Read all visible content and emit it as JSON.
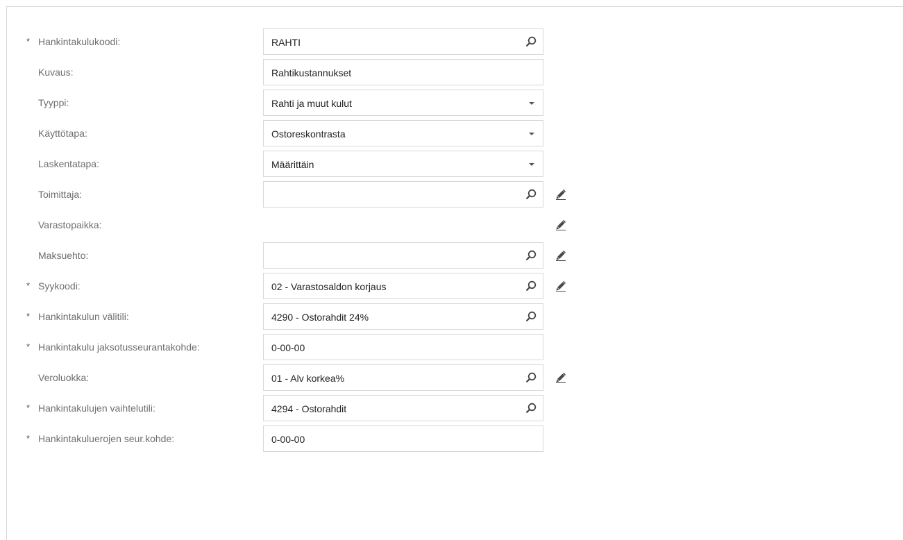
{
  "form": {
    "rows": [
      {
        "required": true,
        "label": "Hankintakulukoodi:",
        "value": "RAHTI",
        "control": "lookup",
        "editable": false
      },
      {
        "required": false,
        "label": "Kuvaus:",
        "value": "Rahtikustannukset",
        "control": "text",
        "editable": false
      },
      {
        "required": false,
        "label": "Tyyppi:",
        "value": "Rahti ja muut kulut",
        "control": "select",
        "editable": false
      },
      {
        "required": false,
        "label": "Käyttötapa:",
        "value": "Ostoreskontrasta",
        "control": "select",
        "editable": false
      },
      {
        "required": false,
        "label": "Laskentatapa:",
        "value": "Määrittäin",
        "control": "select",
        "editable": false
      },
      {
        "required": false,
        "label": "Toimittaja:",
        "value": "",
        "control": "lookup",
        "editable": true
      },
      {
        "required": false,
        "label": "Varastopaikka:",
        "value": "",
        "control": "none",
        "editable": true
      },
      {
        "required": false,
        "label": "Maksuehto:",
        "value": "",
        "control": "lookup",
        "editable": true
      },
      {
        "required": true,
        "label": "Syykoodi:",
        "value": "02 - Varastosaldon korjaus",
        "control": "lookup",
        "editable": true
      },
      {
        "required": true,
        "label": "Hankintakulun välitili:",
        "value": "4290 - Ostorahdit 24%",
        "control": "lookup",
        "editable": false
      },
      {
        "required": true,
        "label": "Hankintakulu jaksotusseurantakohde:",
        "value": "0-00-00",
        "control": "text",
        "editable": false
      },
      {
        "required": false,
        "label": "Veroluokka:",
        "value": "01 - Alv korkea%",
        "control": "lookup",
        "editable": true
      },
      {
        "required": true,
        "label": "Hankintakulujen vaihtelutili:",
        "value": "4294 - Ostorahdit",
        "control": "lookup",
        "editable": false
      },
      {
        "required": true,
        "label": "Hankintakuluerojen seur.kohde:",
        "value": "0-00-00",
        "control": "text",
        "editable": false
      }
    ]
  },
  "symbols": {
    "required_marker": "*"
  },
  "icons": {
    "lookup": "search-icon",
    "select": "chevron-down-icon",
    "edit": "pencil-icon"
  },
  "colors": {
    "label": "#6e6e6e",
    "value": "#222222",
    "border": "#d7d7d7",
    "icon": "#444444"
  }
}
